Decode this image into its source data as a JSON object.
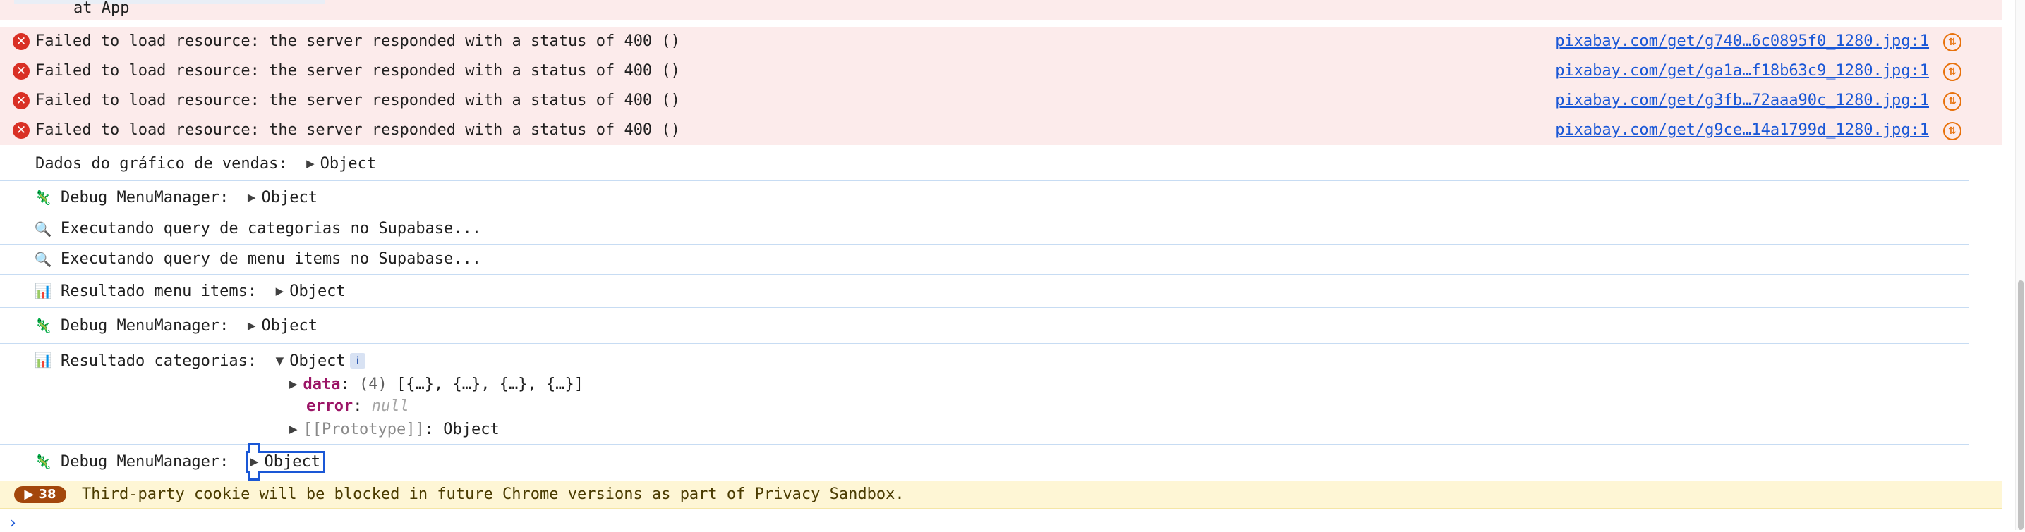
{
  "top_stack_line": "at App",
  "errors": [
    {
      "message": "Failed to load resource: the server responded with a status of 400 ()",
      "source": "pixabay.com/get/g740…6c0895f0_1280.jpg:1"
    },
    {
      "message": "Failed to load resource: the server responded with a status of 400 ()",
      "source": "pixabay.com/get/ga1a…f18b63c9_1280.jpg:1"
    },
    {
      "message": "Failed to load resource: the server responded with a status of 400 ()",
      "source": "pixabay.com/get/g3fb…72aaa90c_1280.jpg:1"
    },
    {
      "message": "Failed to load resource: the server responded with a status of 400 ()",
      "source": "pixabay.com/get/g9ce…14a1799d_1280.jpg:1"
    }
  ],
  "logs": [
    {
      "emoji": "",
      "label": "Dados do gráfico de vendas:",
      "value": "Object"
    },
    {
      "emoji": "🦎",
      "label": "Debug MenuManager:",
      "value": "Object"
    },
    {
      "emoji": "🔍",
      "label": "Executando query de categorias no Supabase...",
      "value": ""
    },
    {
      "emoji": "🔍",
      "label": "Executando query de menu items no Supabase...",
      "value": ""
    },
    {
      "emoji": "📊",
      "label": "Resultado menu items:",
      "value": "Object"
    },
    {
      "emoji": "🦎",
      "label": "Debug MenuManager:",
      "value": "Object"
    },
    {
      "emoji": "📊",
      "label": "Resultado categorias:",
      "value": "Object",
      "info": "i"
    },
    {
      "emoji": "🦎",
      "label": "Debug MenuManager:",
      "value": "Object"
    }
  ],
  "expanded": {
    "data_key": "data",
    "data_count": "(4)",
    "data_value": "[{…}, {…}, {…}, {…}]",
    "error_key": "error",
    "error_value": "null",
    "proto_key": "[[Prototype]]",
    "proto_value": "Object"
  },
  "warning": {
    "count": "38",
    "message": "Third-party cookie will be blocked in future Chrome versions as part of Privacy Sandbox."
  },
  "colors": {
    "error_bg": "#fcebeb",
    "error_icon": "#d93025",
    "link": "#1a57d6",
    "warning_bg": "#fef6d5",
    "warning_badge": "#a3470c",
    "key_color": "#9b1466"
  }
}
